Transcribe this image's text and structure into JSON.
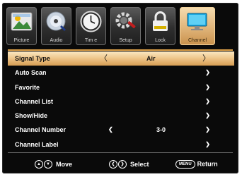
{
  "tabs": [
    {
      "label": "Picture",
      "icon": "picture-icon"
    },
    {
      "label": "Audio",
      "icon": "audio-disc-icon"
    },
    {
      "label": "Tim e",
      "icon": "clock-icon"
    },
    {
      "label": "Setup",
      "icon": "gear-icon"
    },
    {
      "label": "Lock",
      "icon": "lock-icon"
    },
    {
      "label": "Channel",
      "icon": "monitor-icon"
    }
  ],
  "active_tab": "Channel",
  "menu": {
    "signal_type": {
      "label": "Signal Type",
      "value": "Air"
    },
    "auto_scan": {
      "label": "Auto Scan"
    },
    "favorite": {
      "label": "Favorite"
    },
    "channel_list": {
      "label": "Channel List"
    },
    "show_hide": {
      "label": "Show/Hide"
    },
    "channel_number": {
      "label": "Channel Number",
      "value": "3-0"
    },
    "channel_label": {
      "label": "Channel Label"
    }
  },
  "glyphs": {
    "right": "❯",
    "left": "❮",
    "up": "▲",
    "down": "▼",
    "open_left": "〈",
    "open_right": "〉"
  },
  "footer": {
    "move": "Move",
    "select": "Select",
    "menu_key": "MENU",
    "return": "Return"
  },
  "colors": {
    "accent": "#E1A34A",
    "highlight": "#EDC488",
    "background": "#0A0A0A"
  }
}
